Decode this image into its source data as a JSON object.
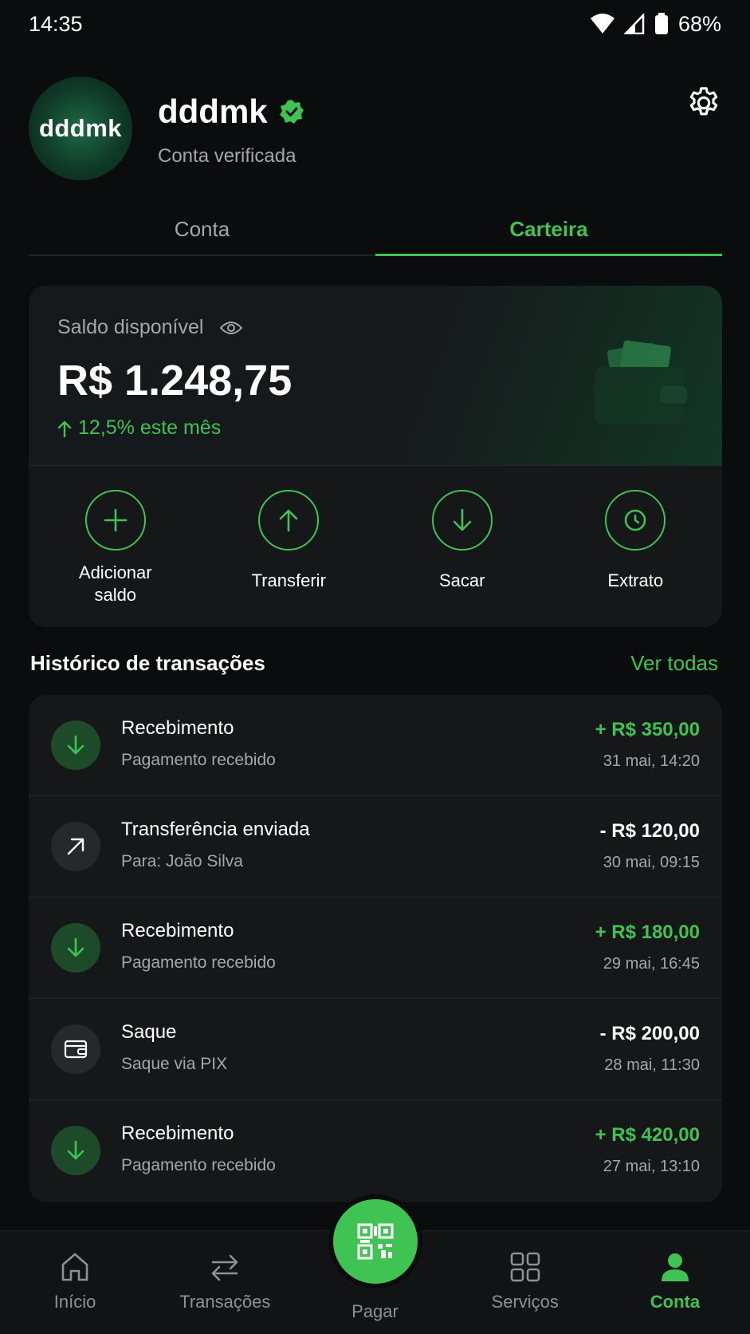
{
  "status_bar": {
    "time": "14:35",
    "battery": "68%"
  },
  "profile": {
    "avatar_text": "dddmk",
    "name": "dddmk",
    "subtitle": "Conta verificada"
  },
  "tabs": [
    {
      "label": "Conta",
      "active": false
    },
    {
      "label": "Carteira",
      "active": true
    }
  ],
  "balance": {
    "label": "Saldo disponível",
    "value": "R$ 1.248,75",
    "change": "12,5% este mês"
  },
  "actions": [
    {
      "label": "Adicionar saldo",
      "icon": "plus-icon"
    },
    {
      "label": "Transferir",
      "icon": "arrow-up-icon"
    },
    {
      "label": "Sacar",
      "icon": "arrow-down-icon"
    },
    {
      "label": "Extrato",
      "icon": "clock-icon"
    }
  ],
  "history": {
    "title": "Histórico de transações",
    "link": "Ver todas",
    "items": [
      {
        "title": "Recebimento",
        "subtitle": "Pagamento recebido",
        "amount": "+ R$ 350,00",
        "date": "31 mai, 14:20",
        "type": "in"
      },
      {
        "title": "Transferência enviada",
        "subtitle": "Para: João Silva",
        "amount": "- R$ 120,00",
        "date": "30 mai, 09:15",
        "type": "transfer"
      },
      {
        "title": "Recebimento",
        "subtitle": "Pagamento recebido",
        "amount": "+ R$ 180,00",
        "date": "29 mai, 16:45",
        "type": "in"
      },
      {
        "title": "Saque",
        "subtitle": "Saque via PIX",
        "amount": "- R$ 200,00",
        "date": "28 mai, 11:30",
        "type": "withdraw"
      },
      {
        "title": "Recebimento",
        "subtitle": "Pagamento recebido",
        "amount": "+ R$ 420,00",
        "date": "27 mai, 13:10",
        "type": "in"
      }
    ]
  },
  "bottom_nav": [
    {
      "label": "Início",
      "icon": "home-icon"
    },
    {
      "label": "Transações",
      "icon": "swap-icon"
    },
    {
      "label": "Pagar",
      "icon": "qr-code-icon"
    },
    {
      "label": "Serviços",
      "icon": "grid-icon"
    },
    {
      "label": "Conta",
      "icon": "person-icon",
      "active": true
    }
  ],
  "colors": {
    "accent": "#3fc352",
    "background": "#0b0c0d",
    "card": "#151719",
    "muted": "#a4a7aa"
  }
}
